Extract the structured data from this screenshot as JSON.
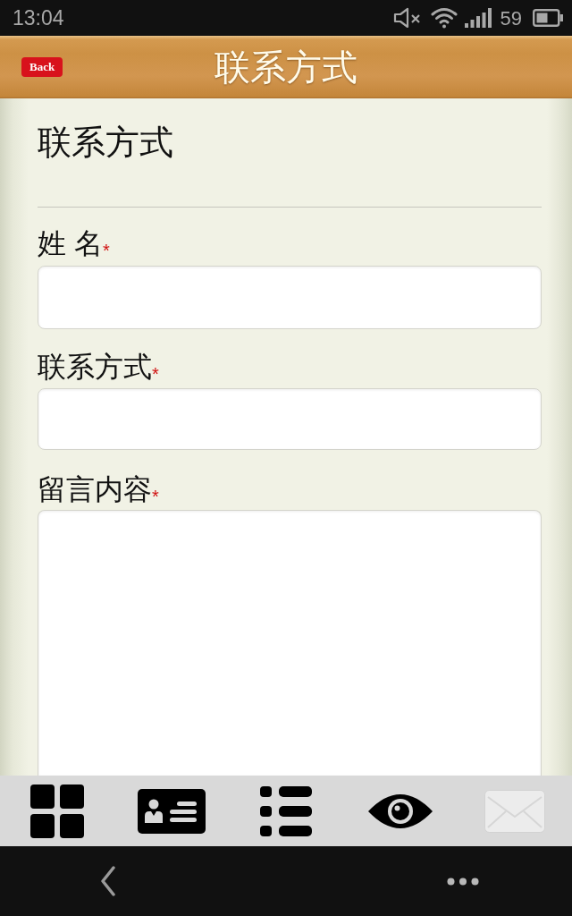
{
  "status_bar": {
    "time": "13:04",
    "battery": "59"
  },
  "header": {
    "back": "Back",
    "title": "联系方式"
  },
  "form": {
    "heading": "联系方式",
    "fields": [
      {
        "kind": "input",
        "label": "姓 名",
        "mark": "*"
      },
      {
        "kind": "input",
        "label": "联系方式",
        "mark": "*"
      },
      {
        "kind": "textarea",
        "label": "留言内容",
        "mark": "*"
      }
    ]
  },
  "tab_bar": [
    {
      "kind": "grid",
      "selected": false
    },
    {
      "kind": "card",
      "selected": false
    },
    {
      "kind": "list",
      "selected": false
    },
    {
      "kind": "eye",
      "selected": false
    },
    {
      "kind": "mail",
      "selected": true
    }
  ]
}
